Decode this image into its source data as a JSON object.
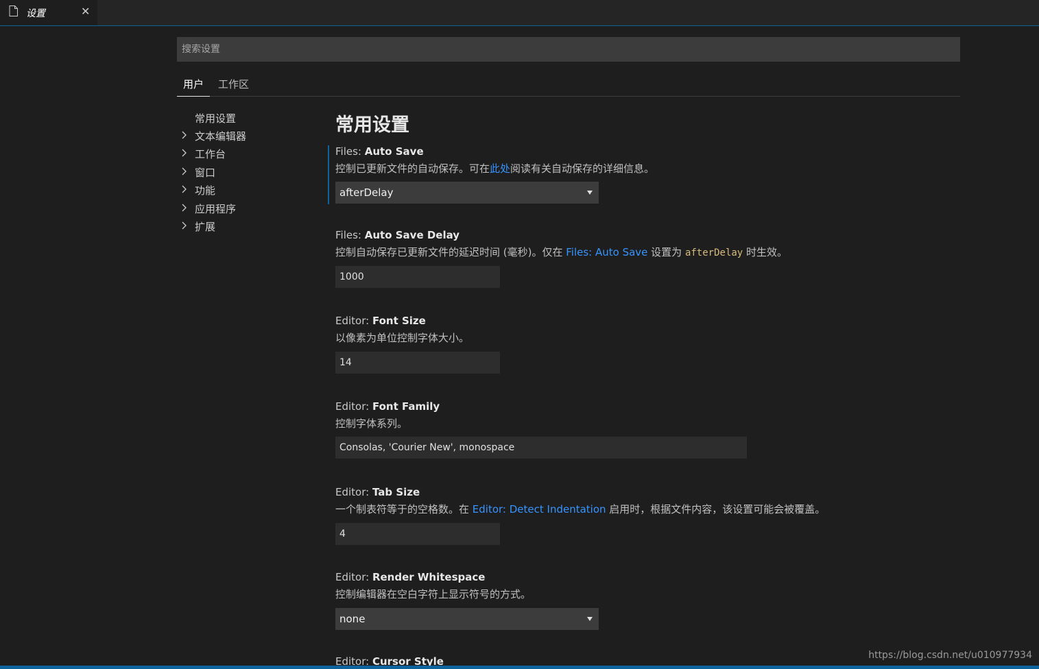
{
  "tab": {
    "title": "设置",
    "close_glyph": "✕",
    "icon": "file-icon"
  },
  "search": {
    "placeholder": "搜索设置",
    "value": ""
  },
  "scope_tabs": [
    {
      "label": "用户",
      "active": true
    },
    {
      "label": "工作区",
      "active": false
    }
  ],
  "toc": [
    {
      "label": "常用设置",
      "expandable": false
    },
    {
      "label": "文本编辑器",
      "expandable": true
    },
    {
      "label": "工作台",
      "expandable": true
    },
    {
      "label": "窗口",
      "expandable": true
    },
    {
      "label": "功能",
      "expandable": true
    },
    {
      "label": "应用程序",
      "expandable": true
    },
    {
      "label": "扩展",
      "expandable": true
    }
  ],
  "section_title": "常用设置",
  "settings": {
    "auto_save": {
      "category": "Files: ",
      "key": "Auto Save",
      "desc_before": "控制已更新文件的自动保存。可在",
      "desc_link": "此处",
      "desc_after": "阅读有关自动保存的详细信息。",
      "value": "afterDelay"
    },
    "auto_save_delay": {
      "category": "Files: ",
      "key": "Auto Save Delay",
      "desc_before": "控制自动保存已更新文件的延迟时间 (毫秒)。仅在 ",
      "desc_link": "Files: Auto Save",
      "desc_mid": " 设置为 ",
      "desc_code": "afterDelay",
      "desc_after": " 时生效。",
      "value": "1000"
    },
    "font_size": {
      "category": "Editor: ",
      "key": "Font Size",
      "desc": "以像素为单位控制字体大小。",
      "value": "14"
    },
    "font_family": {
      "category": "Editor: ",
      "key": "Font Family",
      "desc": "控制字体系列。",
      "value": "Consolas, 'Courier New', monospace"
    },
    "tab_size": {
      "category": "Editor: ",
      "key": "Tab Size",
      "desc_before": "一个制表符等于的空格数。在 ",
      "desc_link": "Editor: Detect Indentation",
      "desc_after": " 启用时，根据文件内容，该设置可能会被覆盖。",
      "value": "4"
    },
    "render_whitespace": {
      "category": "Editor: ",
      "key": "Render Whitespace",
      "desc": "控制编辑器在空白字符上显示符号的方式。",
      "value": "none"
    },
    "cursor_style": {
      "category": "Editor: ",
      "key": "Cursor Style"
    }
  },
  "watermark": "https://blog.csdn.net/u010977934",
  "colors": {
    "accent": "#0e639c",
    "link": "#3794ff",
    "code": "#d7ba7d",
    "background": "#1e1e1e"
  }
}
